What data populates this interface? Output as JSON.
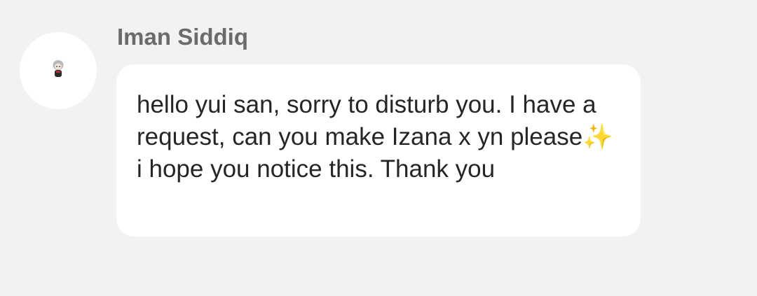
{
  "message": {
    "sender_name": "Iman Siddiq",
    "avatar_icon": "chibi-character-avatar-icon",
    "text": "hello yui san, sorry to disturb you. I have a request, can you make Izana x yn please✨ i hope you notice this. Thank you"
  },
  "colors": {
    "background": "#f2f2f2",
    "bubble": "#ffffff",
    "name": "#6b6b6b",
    "text": "#262626"
  }
}
